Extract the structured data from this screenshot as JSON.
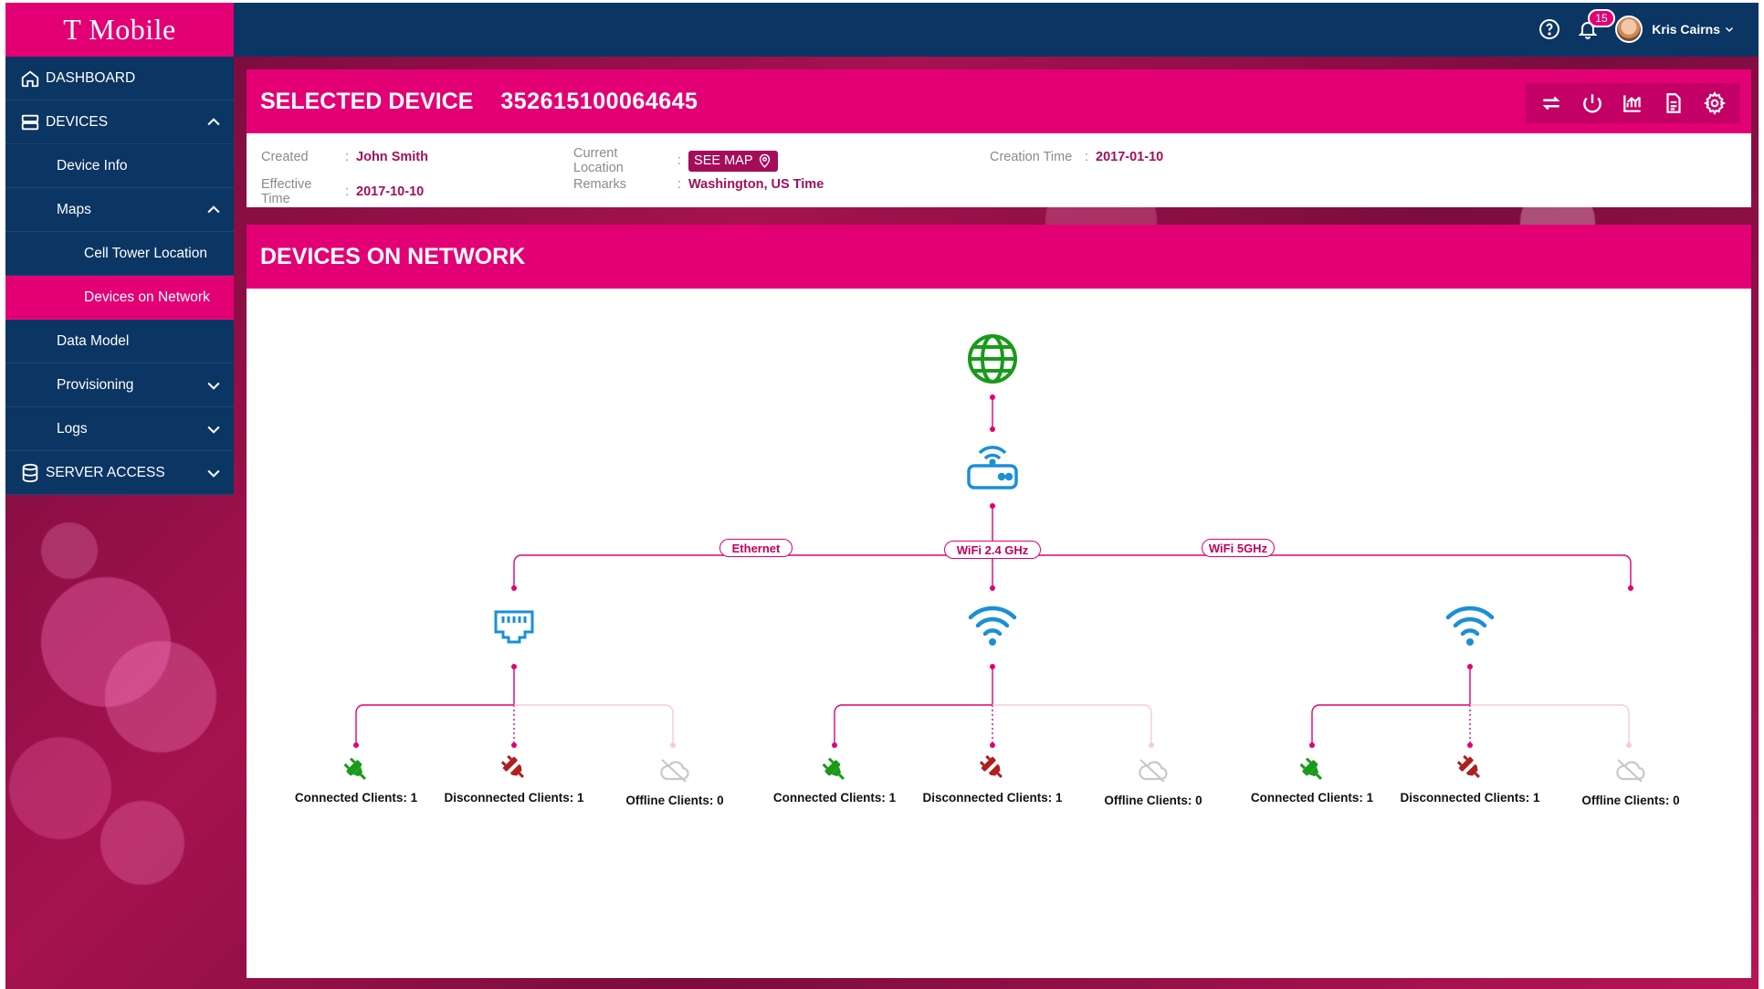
{
  "brand": {
    "logo_text": "T Mobile",
    "primary_color": "#e20074",
    "navy_color": "#0b3563"
  },
  "topbar": {
    "notification_count": "15",
    "user_name": "Kris Cairns",
    "icons": [
      "help-icon",
      "bell-icon",
      "chevron-down-icon"
    ]
  },
  "sidebar": {
    "dashboard": "DASHBOARD",
    "devices": "DEVICES",
    "device_info": "Device Info",
    "maps": "Maps",
    "cell_tower": "Cell Tower Location",
    "devices_on_network": "Devices on Network",
    "data_model": "Data Model",
    "provisioning": "Provisioning",
    "logs": "Logs",
    "server_access": "SERVER ACCESS"
  },
  "selected_device": {
    "title": "SELECTED DEVICE",
    "serial": "352615100064645",
    "tools": [
      "sync-icon",
      "power-icon",
      "chart-icon",
      "document-icon",
      "settings-icon"
    ],
    "created_label": "Created",
    "created_value": "John Smith",
    "effective_label": "Effective Time",
    "effective_value": "2017-10-10",
    "location_label": "Current Location",
    "see_map": "SEE MAP",
    "remarks_label": "Remarks",
    "remarks_value": "Washington, US Time",
    "creation_label": "Creation Time",
    "creation_value": "2017-01-10",
    "separator": ":"
  },
  "network": {
    "title": "DEVICES ON NETWORK",
    "links": {
      "ethernet": "Ethernet",
      "wifi24": "WiFi 2.4 GHz",
      "wifi5": "WiFi 5GHz"
    },
    "groups": [
      {
        "connected": "Connected Clients: 1",
        "disconnected": "Disconnected Clients: 1",
        "offline": "Offline Clients: 0"
      },
      {
        "connected": "Connected Clients: 1",
        "disconnected": "Disconnected Clients: 1",
        "offline": "Offline Clients: 0"
      },
      {
        "connected": "Connected Clients: 1",
        "disconnected": "Disconnected Clients: 1",
        "offline": "Offline Clients: 0"
      }
    ],
    "colors": {
      "internet": "#1a9a1a",
      "device": "#1a8fd8",
      "line": "#e20074",
      "connected": "#1a9a1a",
      "disconnected": "#b11e1e",
      "offline": "#c8c8c8"
    }
  }
}
